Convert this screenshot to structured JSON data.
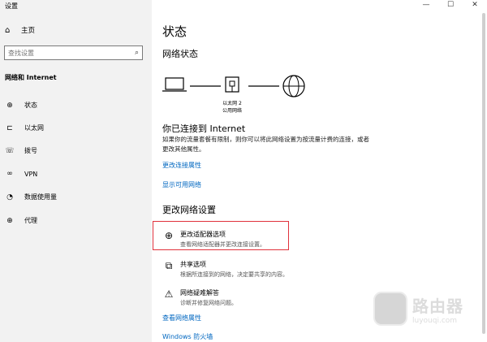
{
  "window": {
    "title": "设置",
    "controls": [
      "—",
      "☐",
      "✕"
    ]
  },
  "sidebar": {
    "home_label": "主页",
    "search_placeholder": "查找设置",
    "section_title": "网络和 Internet",
    "items": [
      {
        "label": "状态",
        "icon": "status-icon"
      },
      {
        "label": "以太网",
        "icon": "ethernet-icon"
      },
      {
        "label": "拨号",
        "icon": "dialup-icon"
      },
      {
        "label": "VPN",
        "icon": "vpn-icon"
      },
      {
        "label": "数据使用量",
        "icon": "data-usage-icon"
      },
      {
        "label": "代理",
        "icon": "proxy-icon"
      }
    ]
  },
  "main": {
    "title": "状态",
    "network_status_heading": "网络状态",
    "diagram": {
      "adapter_name": "以太网 2",
      "network_type": "公用网络"
    },
    "connected_heading": "你已连接到 Internet",
    "description": "如果你的流量套餐有限制，则你可以将此网络设置为按流量计费的连接，或者更改其他属性。",
    "link_change_props": "更改连接属性",
    "link_show_networks": "显示可用网络",
    "change_settings_heading": "更改网络设置",
    "options": [
      {
        "title": "更改适配器选项",
        "subtitle": "查看网络适配器并更改连接设置。",
        "icon": "adapter-icon"
      },
      {
        "title": "共享选项",
        "subtitle": "根据所连接到的网络，决定要共享的内容。",
        "icon": "sharing-icon"
      },
      {
        "title": "网络疑难解答",
        "subtitle": "诊断并修复网络问题。",
        "icon": "warning-icon"
      }
    ],
    "link_view_props": "查看网络属性",
    "link_firewall": "Windows 防火墙"
  },
  "watermark": {
    "main": "路由器",
    "sub": "luyouqi.com"
  },
  "colors": {
    "link": "#0067c0",
    "highlight": "#e0323c",
    "sidebar_bg": "#f2f2f2"
  }
}
